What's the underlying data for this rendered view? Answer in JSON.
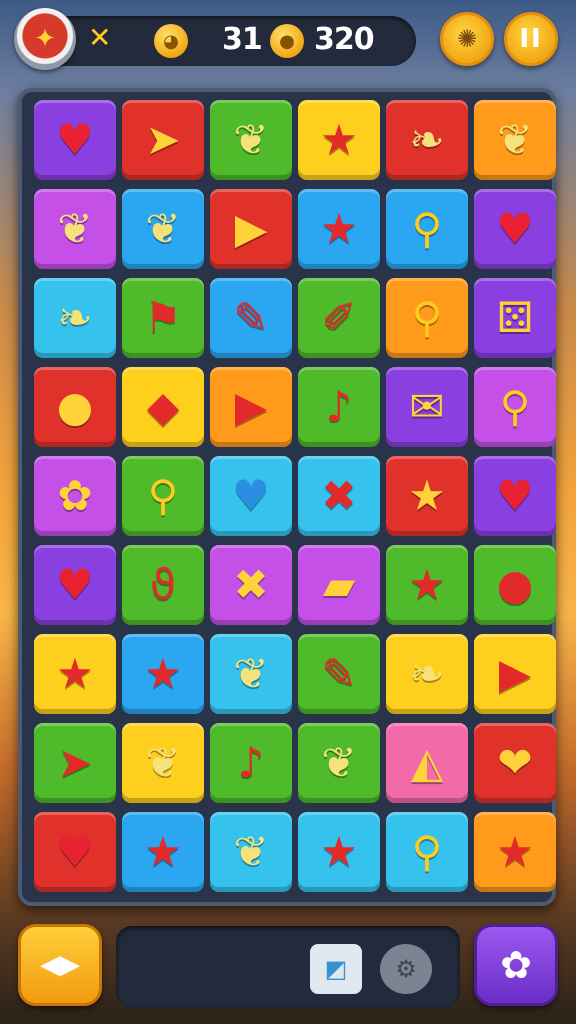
{
  "hud": {
    "avatar_icon": "bag-icon",
    "multiplier_symbol": "✕",
    "moves_count": "31",
    "score": "320",
    "coin_symbol": "●",
    "menu_icon": "cookie-icon",
    "pause_icon": "pause-icon",
    "pause_symbol": "II"
  },
  "colors": {
    "purple": "#8a3fe0",
    "red": "#e0322b",
    "green": "#4fba2a",
    "yellow": "#ffcf1e",
    "orange": "#ff9a1a",
    "blue": "#2aa7f0",
    "cyan": "#35c3ee",
    "magenta": "#c550e8",
    "pink": "#f26aa8"
  },
  "board": {
    "rows": [
      [
        {
          "color": "purple",
          "icon": "heart-icon",
          "glyph": "♥"
        },
        {
          "color": "red",
          "icon": "arrow-icon",
          "glyph": "➤"
        },
        {
          "color": "green",
          "icon": "leaf-icon",
          "glyph": "❦"
        },
        {
          "color": "yellow",
          "icon": "star-icon",
          "glyph": "★"
        },
        {
          "color": "red",
          "icon": "feather-icon",
          "glyph": "❧"
        },
        {
          "color": "orange",
          "icon": "leaf-icon",
          "glyph": "❦"
        }
      ],
      [
        {
          "color": "magenta",
          "icon": "leaf-icon",
          "glyph": "❦"
        },
        {
          "color": "blue",
          "icon": "leaf-icon",
          "glyph": "❦"
        },
        {
          "color": "red",
          "icon": "triangle-icon",
          "glyph": "▶"
        },
        {
          "color": "blue",
          "icon": "star-icon",
          "glyph": "★"
        },
        {
          "color": "blue",
          "icon": "key-icon",
          "glyph": "⚲"
        },
        {
          "color": "purple",
          "icon": "heart-icon",
          "glyph": "♥"
        }
      ],
      [
        {
          "color": "cyan",
          "icon": "feather-icon",
          "glyph": "❧"
        },
        {
          "color": "green",
          "icon": "flag-icon",
          "glyph": "⚑"
        },
        {
          "color": "blue",
          "icon": "pencil-icon",
          "glyph": "✎"
        },
        {
          "color": "green",
          "icon": "brush-icon",
          "glyph": "✐"
        },
        {
          "color": "orange",
          "icon": "key-icon",
          "glyph": "⚲"
        },
        {
          "color": "purple",
          "icon": "dice-icon",
          "glyph": "⚄"
        }
      ],
      [
        {
          "color": "red",
          "icon": "fruit-icon",
          "glyph": "●"
        },
        {
          "color": "yellow",
          "icon": "bow-icon",
          "glyph": "◆"
        },
        {
          "color": "orange",
          "icon": "triangle-icon",
          "glyph": "▶"
        },
        {
          "color": "green",
          "icon": "match-icon",
          "glyph": "♪"
        },
        {
          "color": "purple",
          "icon": "card-icon",
          "glyph": "✉"
        },
        {
          "color": "magenta",
          "icon": "key-icon",
          "glyph": "⚲"
        }
      ],
      [
        {
          "color": "magenta",
          "icon": "flower-icon",
          "glyph": "✿"
        },
        {
          "color": "green",
          "icon": "key-icon",
          "glyph": "⚲"
        },
        {
          "color": "cyan",
          "icon": "heart-icon",
          "glyph": "♥"
        },
        {
          "color": "cyan",
          "icon": "cross-icon",
          "glyph": "✖"
        },
        {
          "color": "red",
          "icon": "star-icon",
          "glyph": "★"
        },
        {
          "color": "purple",
          "icon": "heart-icon",
          "glyph": "♥"
        }
      ],
      [
        {
          "color": "purple",
          "icon": "heart-icon",
          "glyph": "♥"
        },
        {
          "color": "green",
          "icon": "ribbon-icon",
          "glyph": "ϑ"
        },
        {
          "color": "magenta",
          "icon": "cross-icon",
          "glyph": "✖"
        },
        {
          "color": "magenta",
          "icon": "bar-icon",
          "glyph": "▰"
        },
        {
          "color": "green",
          "icon": "star-icon",
          "glyph": "★"
        },
        {
          "color": "green",
          "icon": "apple-icon",
          "glyph": "●"
        }
      ],
      [
        {
          "color": "yellow",
          "icon": "star-icon",
          "glyph": "★"
        },
        {
          "color": "blue",
          "icon": "star-icon",
          "glyph": "★"
        },
        {
          "color": "cyan",
          "icon": "leaf-icon",
          "glyph": "❦"
        },
        {
          "color": "green",
          "icon": "pencil-icon",
          "glyph": "✎"
        },
        {
          "color": "yellow",
          "icon": "feather-icon",
          "glyph": "❧"
        },
        {
          "color": "yellow",
          "icon": "triangle-icon",
          "glyph": "▶"
        }
      ],
      [
        {
          "color": "green",
          "icon": "arrow-icon",
          "glyph": "➤"
        },
        {
          "color": "yellow",
          "icon": "leaf-icon",
          "glyph": "❦"
        },
        {
          "color": "green",
          "icon": "horn-icon",
          "glyph": "♪"
        },
        {
          "color": "green",
          "icon": "leaf-icon",
          "glyph": "❦"
        },
        {
          "color": "pink",
          "icon": "cheese-icon",
          "glyph": "◭"
        },
        {
          "color": "red",
          "icon": "fruit-icon",
          "glyph": "❤"
        }
      ],
      [
        {
          "color": "red",
          "icon": "heart-icon",
          "glyph": "♥"
        },
        {
          "color": "blue",
          "icon": "star-icon",
          "glyph": "★"
        },
        {
          "color": "cyan",
          "icon": "leaf-icon",
          "glyph": "❦"
        },
        {
          "color": "cyan",
          "icon": "star-icon",
          "glyph": "★"
        },
        {
          "color": "cyan",
          "icon": "key-icon",
          "glyph": "⚲"
        },
        {
          "color": "orange",
          "icon": "star-icon",
          "glyph": "★"
        }
      ]
    ]
  },
  "footer": {
    "swap_icon": "swap-arrows-icon",
    "swap_symbol": "◀▶",
    "tray_items": [
      {
        "icon": "picture-icon",
        "glyph": "◩"
      },
      {
        "icon": "gear-icon",
        "glyph": "⚙"
      }
    ],
    "powerup_icon": "flower-icon",
    "powerup_symbol": "✿"
  }
}
